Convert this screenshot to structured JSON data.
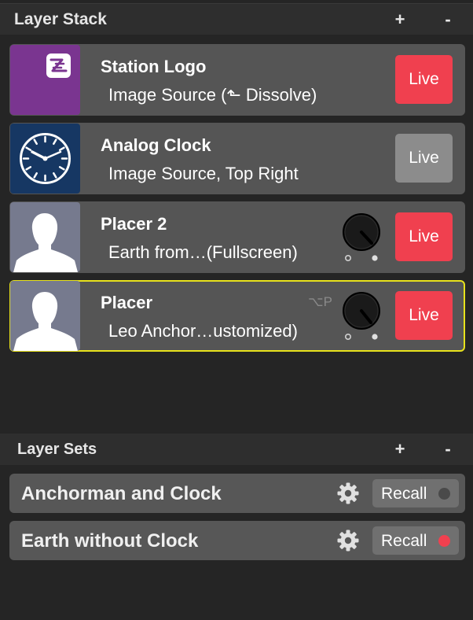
{
  "layer_stack": {
    "title": "Layer Stack",
    "add_label": "+",
    "remove_label": "-",
    "layers": [
      {
        "name": "Station Logo",
        "subtitle": "Image Source (⬑ Dissolve)",
        "live_label": "Live",
        "live_on": true,
        "thumbnail": "station-logo-thumbnail"
      },
      {
        "name": "Analog Clock",
        "subtitle": "Image Source, Top Right",
        "live_label": "Live",
        "live_on": false,
        "thumbnail": "analog-clock-thumbnail"
      },
      {
        "name": "Placer 2",
        "subtitle": "Earth from…(Fullscreen)",
        "live_label": "Live",
        "live_on": true,
        "thumbnail": "person-silhouette-thumbnail"
      },
      {
        "name": "Placer",
        "subtitle": "Leo Anchor…ustomized)",
        "live_label": "Live",
        "live_on": true,
        "shortcut": "⌥P",
        "thumbnail": "person-silhouette-thumbnail",
        "selected": true
      }
    ]
  },
  "layer_sets": {
    "title": "Layer Sets",
    "add_label": "+",
    "remove_label": "-",
    "sets": [
      {
        "name": "Anchorman and Clock",
        "recall_label": "Recall",
        "indicator": "off"
      },
      {
        "name": "Earth without Clock",
        "recall_label": "Recall",
        "indicator": "on"
      }
    ]
  },
  "colors": {
    "live_red": "#f0404f",
    "live_off_gray": "#8c8c8c",
    "selected_outline": "#e8e21c",
    "logo_purple": "#7a3590",
    "clock_navy": "#163763",
    "placeholder_gray": "#767a8e"
  }
}
